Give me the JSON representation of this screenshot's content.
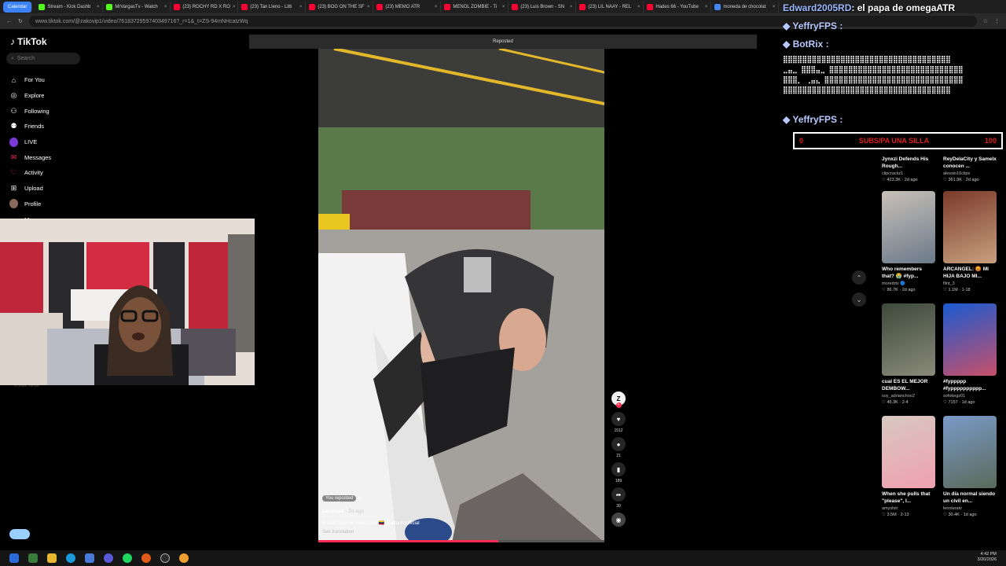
{
  "browser": {
    "tabs": [
      {
        "label": "Calendar",
        "color": "#3b82f6",
        "group": true
      },
      {
        "label": "Stream - Kick Dashb",
        "color": "#53fc18"
      },
      {
        "label": "MrVargasTv - Watch",
        "color": "#53fc18"
      },
      {
        "label": "(23) ROCHY RD X RO",
        "color": "#ff0033"
      },
      {
        "label": "(23) Tan Lleno - Litti",
        "color": "#ff0033"
      },
      {
        "label": "(23) BOG ON THE SF",
        "color": "#ff0033"
      },
      {
        "label": "(23) MEMO ATR",
        "color": "#ff0033"
      },
      {
        "label": "MENOL ZOMBIE - Ti",
        "color": "#ff0033"
      },
      {
        "label": "(23) Luis Brown - SN",
        "color": "#ff0033"
      },
      {
        "label": "(23) LIL NAAY - REL",
        "color": "#ff0033"
      },
      {
        "label": "Hades 66 - YouTube",
        "color": "#ff0033"
      },
      {
        "label": "moneda de chocolat",
        "color": "#4285f4"
      }
    ],
    "url": "www.tiktok.com/@zakovip1/video/7618372959740349716?_r=1&_t=ZS-94mNHcatzWq"
  },
  "sidebar": {
    "logo": "TikTok",
    "search_placeholder": "Search",
    "items": [
      {
        "label": "For You",
        "icon": "home-icon"
      },
      {
        "label": "Explore",
        "icon": "compass-icon"
      },
      {
        "label": "Following",
        "icon": "following-icon"
      },
      {
        "label": "Friends",
        "icon": "friends-icon"
      },
      {
        "label": "LIVE",
        "icon": "live-icon"
      },
      {
        "label": "Messages",
        "icon": "messages-icon"
      },
      {
        "label": "Activity",
        "icon": "activity-icon"
      },
      {
        "label": "Upload",
        "icon": "upload-icon"
      },
      {
        "label": "Profile",
        "icon": "profile-icon"
      },
      {
        "label": "More",
        "icon": "more-icon"
      }
    ],
    "copyright": "© 2026 TikTok"
  },
  "player": {
    "reposted_label": "Reposted",
    "you_reposted": "You reposted",
    "username": "zakovip1",
    "time_ago": "· 2d ago",
    "caption": "El más duro de Venezuela 🇻🇪 @attachoofficial",
    "see_translation": "See translation",
    "likes": "1512",
    "comments": "21",
    "saves": "189",
    "shares": "39",
    "progress": 0.63
  },
  "stream_overlay": {
    "header": ": el papa de omegaATR",
    "header_user": "Edward2005RD",
    "users": [
      "YeffryFPS :",
      "BotRix :",
      "YeffryFPS :"
    ],
    "goal_left": "0",
    "goal_text": "SUBS/PA UNA SILLA",
    "goal_right": "100",
    "goal_progress": 0.0
  },
  "feed": [
    {
      "title": "Jynxzi Defends His Rough...",
      "user": "clipcrackz1",
      "stats": "♡ 423.3K · 2d ago",
      "colors": [
        "#5a4a44",
        "#b89a8a"
      ]
    },
    {
      "title": "ReyDelaCity y Samelx conocen ...",
      "user": "alessio16clips",
      "stats": "♡ 361.9K · 2d ago",
      "colors": [
        "#3a3030",
        "#a05050"
      ]
    },
    {
      "title": "Who remembers that? 😭 #fyp...",
      "user": "moredrtv 🔵",
      "stats": "♡ 86.7K · 2d ago",
      "colors": [
        "#c8c0b8",
        "#6b7a8a"
      ]
    },
    {
      "title": "ARCANGEL: 😡 MI HIJA BAJO MI...",
      "user": "flint_3",
      "stats": "♡ 1.1M · 1-18",
      "colors": [
        "#7a3a2a",
        "#c9a080"
      ]
    },
    {
      "title": "cual ES EL MEJOR DEMBOW...",
      "user": "soy_adrianchoo2",
      "stats": "♡ 46.3K · 2-4",
      "colors": [
        "#3d4a3a",
        "#8a8a7a"
      ]
    },
    {
      "title": "#fyppppp #fypppppppppp...",
      "user": "sofokegz01",
      "stats": "♡ 7157 · 1d ago",
      "colors": [
        "#1a5ad0",
        "#c8506a"
      ]
    },
    {
      "title": "When she pulls that \"please\", I...",
      "user": "amyshin",
      "stats": "♡ 3.5M · 2-13",
      "colors": [
        "#d8c8c0",
        "#f0a0b0"
      ]
    },
    {
      "title": "Un día normal siendo un civil en...",
      "user": "leonlaratv",
      "stats": "♡ 30.4K · 1d ago",
      "colors": [
        "#7a9ac8",
        "#5a6a5a"
      ]
    }
  ],
  "taskbar": {
    "time": "4:42 PM",
    "date": "3/20/2026"
  }
}
